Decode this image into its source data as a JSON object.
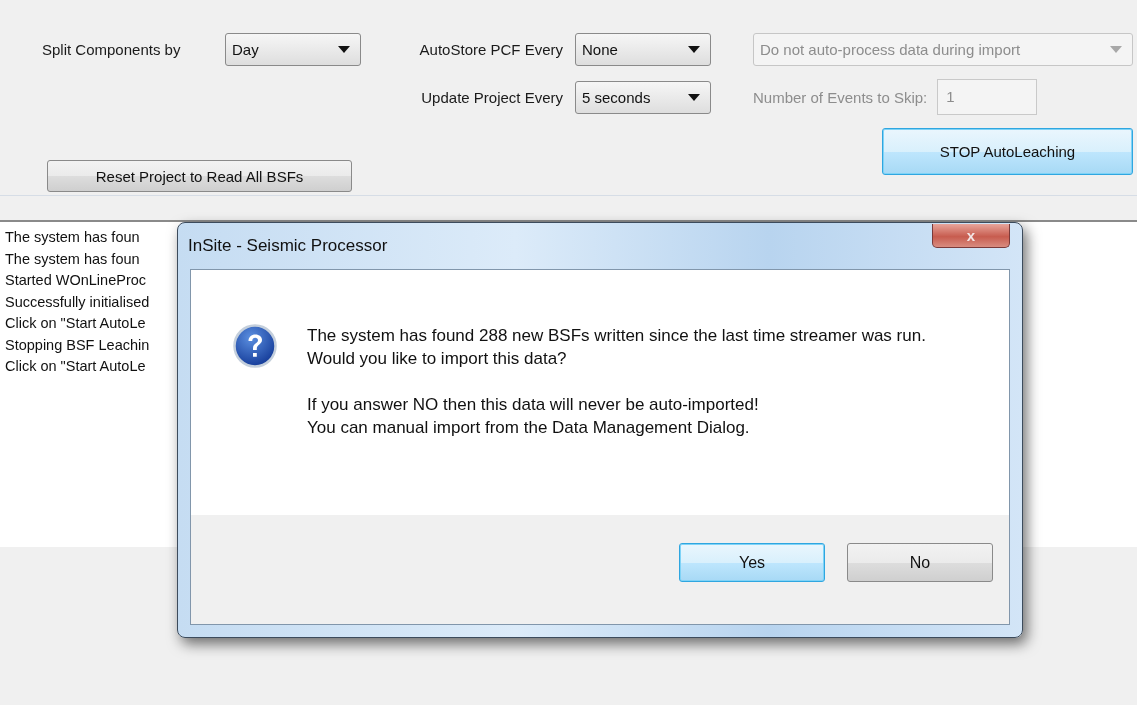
{
  "settings": {
    "split_label": "Split Components by",
    "split_value": "Day",
    "autostore_label": "AutoStore PCF Every",
    "autostore_value": "None",
    "process_mode": {
      "value": "Do not auto-process data during import",
      "disabled": true
    },
    "update_label": "Update Project Every",
    "update_value": "5 seconds",
    "skip": {
      "label": "Number of Events to Skip:",
      "value": "1",
      "disabled": true
    },
    "reset_button": "Reset Project to Read All BSFs",
    "stop_button": {
      "label": "STOP AutoLeaching",
      "default": true
    }
  },
  "log": [
    "The system has foun",
    "The system has foun",
    "Started WOnLineProc",
    "Successfully initialised",
    "Click on \"Start AutoLe",
    "Stopping BSF Leachin",
    "Click on \"Start AutoLe"
  ],
  "dialog": {
    "title": "InSite - Seismic Processor",
    "close": "x",
    "message": [
      [
        "The system has found 288 new BSFs written since the last time streamer was run.",
        "Would you like to import this data?"
      ],
      [
        "If you answer NO then this data will never be auto-imported!",
        "You can manual import from the Data Management Dialog."
      ]
    ],
    "buttons": [
      {
        "label": "Yes",
        "default": true
      },
      {
        "label": "No",
        "default": false
      }
    ]
  }
}
